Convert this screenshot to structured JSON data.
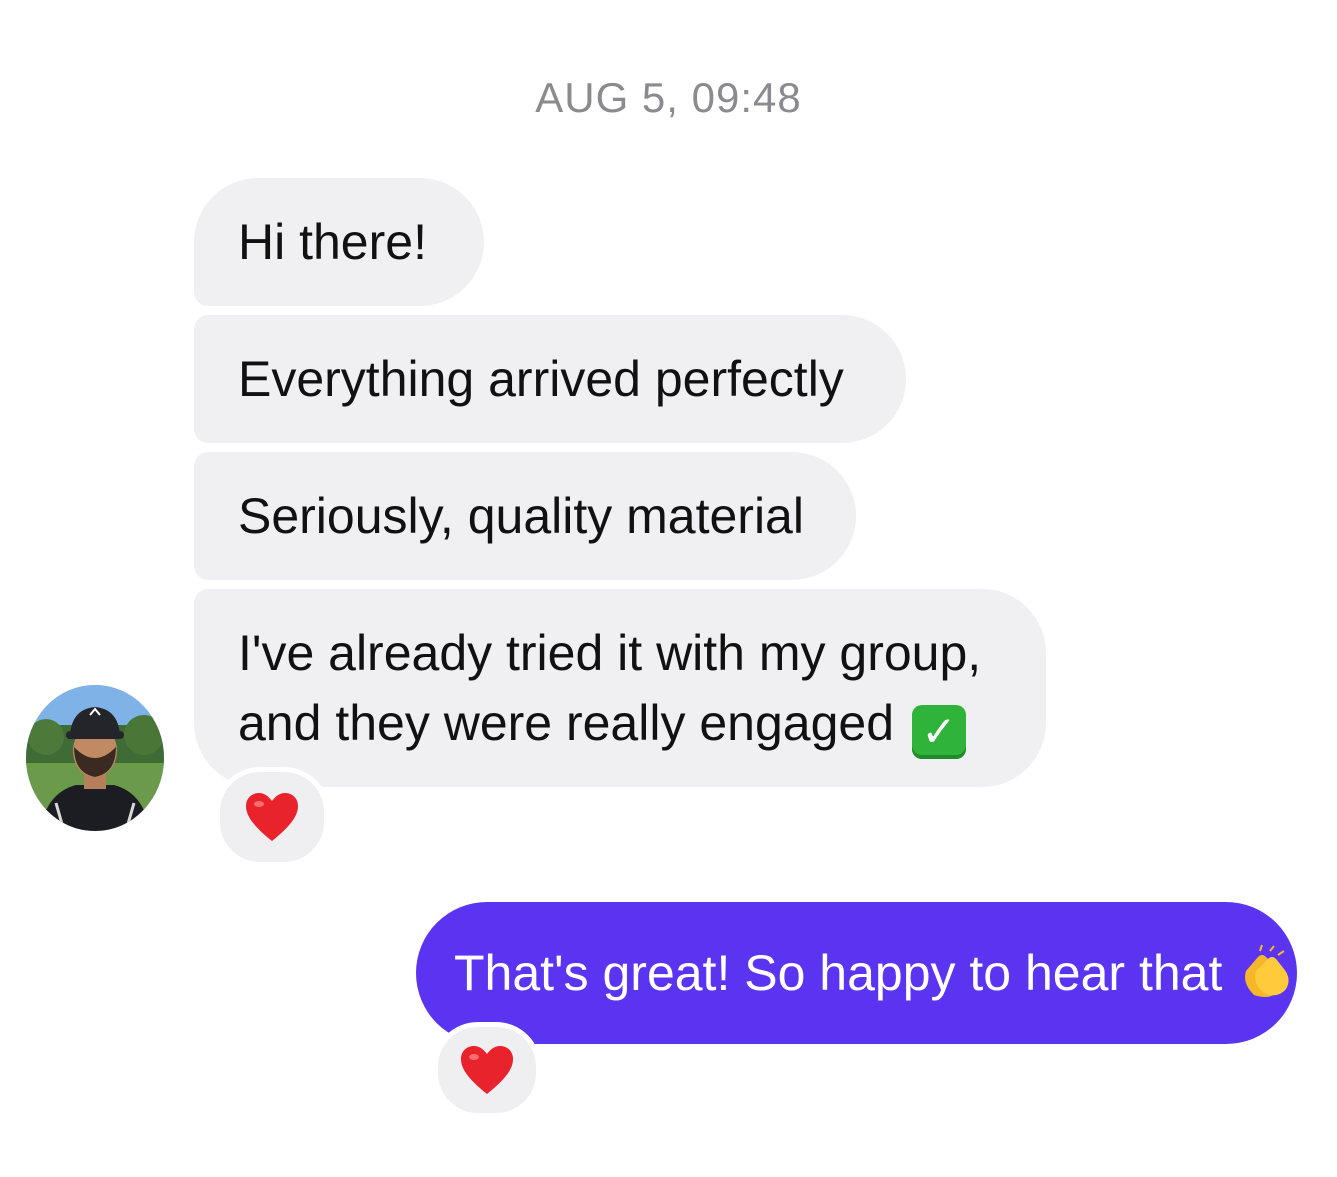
{
  "conversation": {
    "timestamp": "AUG 5, 09:48",
    "received": [
      {
        "text": "Hi there!"
      },
      {
        "text": "Everything arrived perfectly"
      },
      {
        "text": "Seriously, quality material"
      },
      {
        "line1": "I've already tried it with my group,",
        "line2": "and they were really engaged",
        "emoji": "check-mark-button-icon"
      }
    ],
    "received_reaction": "heart-icon",
    "sent": {
      "text": "That's great! So happy to hear that",
      "emoji": "clapping-hands-icon"
    },
    "sent_reaction": "heart-icon"
  },
  "colors": {
    "received_bubble": "#f0f0f2",
    "sent_bubble": "#5b34f2",
    "timestamp_text": "#8a8a8f",
    "heart": "#e8232b"
  }
}
